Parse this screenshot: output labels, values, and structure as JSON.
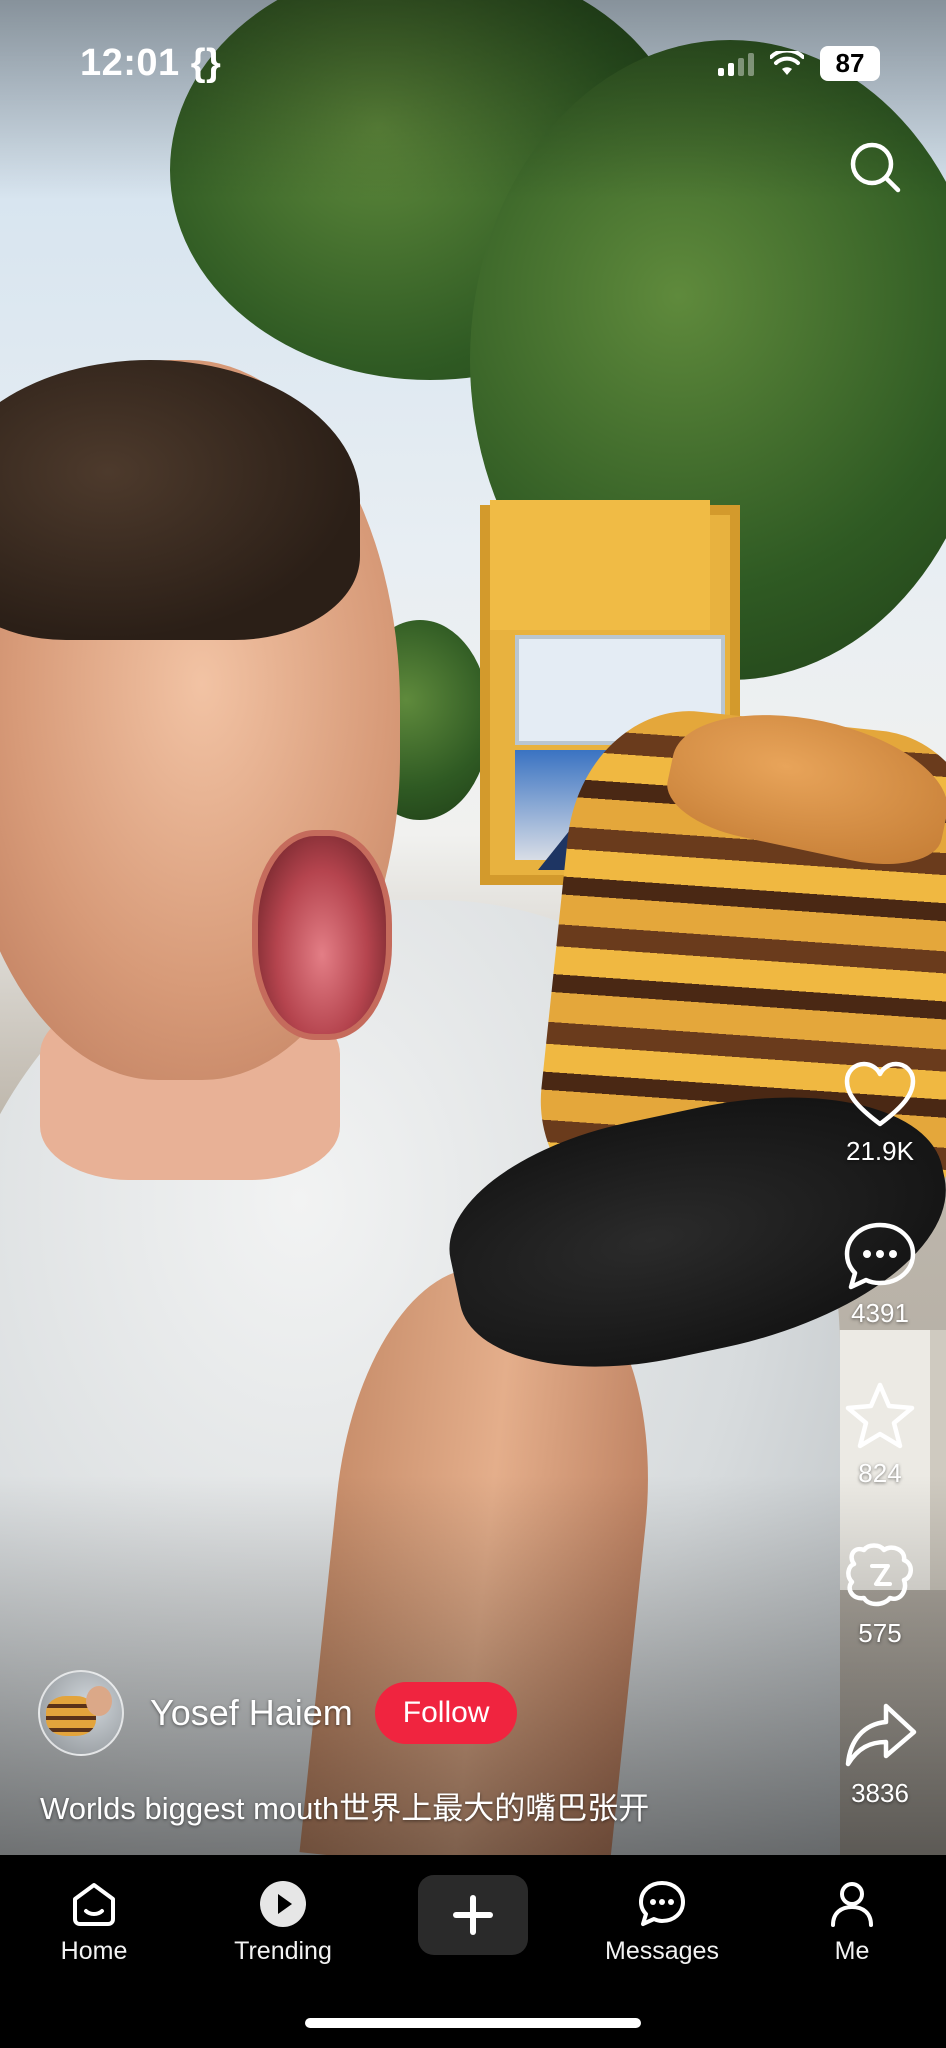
{
  "status_bar": {
    "time": "12:01 {}",
    "battery": "87"
  },
  "post": {
    "author_name": "Yosef Haiem",
    "follow_label": "Follow",
    "caption": "Worlds biggest mouth世界上最大的嘴巴张开"
  },
  "actions": {
    "likes": "21.9K",
    "comments": "4391",
    "favorites": "824",
    "gifts": "575",
    "shares": "3836"
  },
  "nav": {
    "home": "Home",
    "trending": "Trending",
    "create": "",
    "messages": "Messages",
    "me": "Me"
  },
  "colors": {
    "follow_button": "#f0243f",
    "nav_background": "#000000",
    "create_button": "#2a2a2a"
  },
  "icons": {
    "search": "search-icon",
    "like": "heart-icon",
    "comment": "comment-bubble-icon",
    "favorite": "star-icon",
    "gift": "gift-icon",
    "share": "share-arrow-icon",
    "home": "home-icon",
    "trending": "play-circle-icon",
    "create": "plus-icon",
    "messages": "chat-icon",
    "me": "person-icon"
  }
}
